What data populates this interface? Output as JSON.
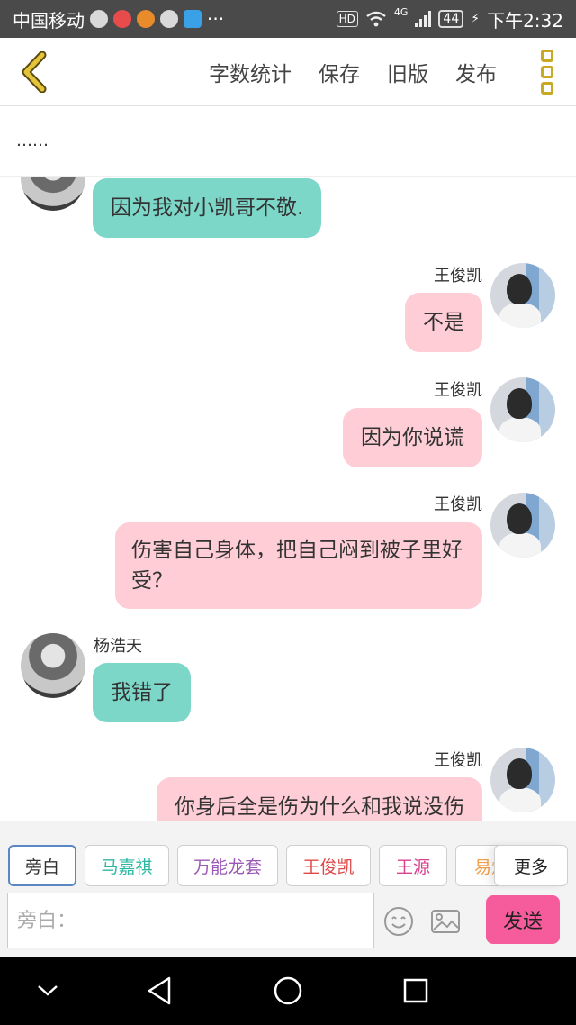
{
  "status_bar": {
    "carrier": "中国移动",
    "more": "···",
    "hd": "HD",
    "network": "4G",
    "battery": "44",
    "time": "下午2:32"
  },
  "toolbar": {
    "word_count": "字数统计",
    "save": "保存",
    "old_version": "旧版",
    "publish": "发布"
  },
  "subtitle": "……",
  "messages": [
    {
      "side": "left",
      "sender": "",
      "text": "因为我对小凯哥不敬."
    },
    {
      "side": "right",
      "sender": "王俊凯",
      "text": "不是"
    },
    {
      "side": "right",
      "sender": "王俊凯",
      "text": "因为你说谎"
    },
    {
      "side": "right",
      "sender": "王俊凯",
      "text": "伤害自己身体，把自己闷到被子里好受？"
    },
    {
      "side": "left",
      "sender": "杨浩天",
      "text": "我错了"
    },
    {
      "side": "right",
      "sender": "王俊凯",
      "text": "你身后全是伤为什么和我说没伤"
    }
  ],
  "roles": [
    {
      "label": "旁白",
      "color": "#333333"
    },
    {
      "label": "马嘉祺",
      "color": "#2fb7a4"
    },
    {
      "label": "万能龙套",
      "color": "#9b59b6"
    },
    {
      "label": "王俊凯",
      "color": "#e04848"
    },
    {
      "label": "王源",
      "color": "#d9428f"
    },
    {
      "label": "易烊",
      "color": "#f0a04b"
    }
  ],
  "more_roles": "更多",
  "input": {
    "placeholder": "旁白："
  },
  "send": "发送",
  "colors": {
    "accent": "#c9a923",
    "left_bubble": "#7dd7c9",
    "right_bubble": "#fecdd6",
    "send_button": "#f65c9b"
  }
}
